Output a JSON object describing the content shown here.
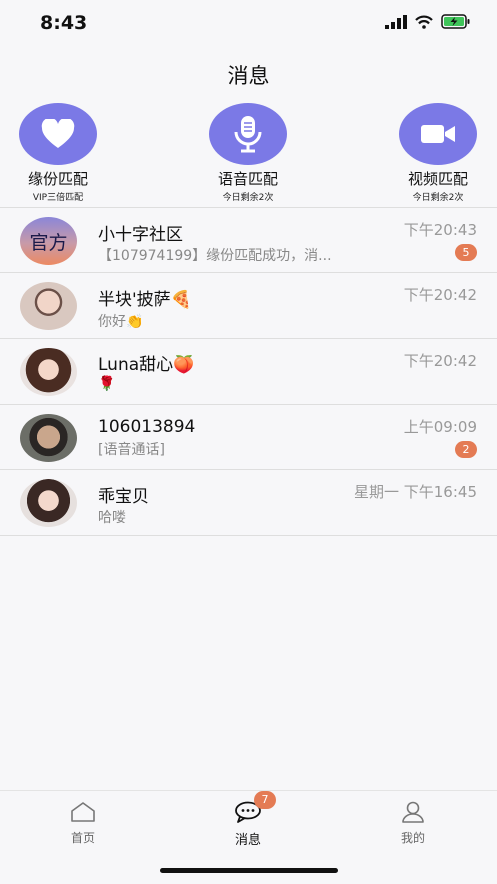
{
  "status_bar": {
    "time": "8:43"
  },
  "header": {
    "title": "消息"
  },
  "matches": [
    {
      "label": "缘份匹配",
      "sub": "VIP三倍匹配",
      "icon": "heart-icon"
    },
    {
      "label": "语音匹配",
      "sub": "今日剩余2次",
      "icon": "microphone-icon"
    },
    {
      "label": "视频匹配",
      "sub": "今日剩余2次",
      "icon": "video-camera-icon"
    }
  ],
  "conversations": [
    {
      "name": "小十字社区",
      "avatar_text": "官方",
      "preview": "【107974199】缘份匹配成功，消...",
      "time": "下午20:43",
      "badge": "5"
    },
    {
      "name": "半块'披萨🍕",
      "preview": "你好👏",
      "time": "下午20:42",
      "badge": ""
    },
    {
      "name": "Luna甜心🍑",
      "preview": "🌹",
      "time": "下午20:42",
      "badge": ""
    },
    {
      "name": "106013894",
      "preview": "[语音通话]",
      "time": "上午09:09",
      "badge": "2"
    },
    {
      "name": "乖宝贝",
      "preview": "哈喽",
      "time": "星期一 下午16:45",
      "badge": ""
    }
  ],
  "tabbar": {
    "tabs": [
      {
        "label": "首页",
        "icon": "home-icon"
      },
      {
        "label": "消息",
        "icon": "chat-icon",
        "badge": "7"
      },
      {
        "label": "我的",
        "icon": "user-icon"
      }
    ]
  },
  "colors": {
    "accent": "#7b79e6",
    "badge": "#e47b54"
  }
}
